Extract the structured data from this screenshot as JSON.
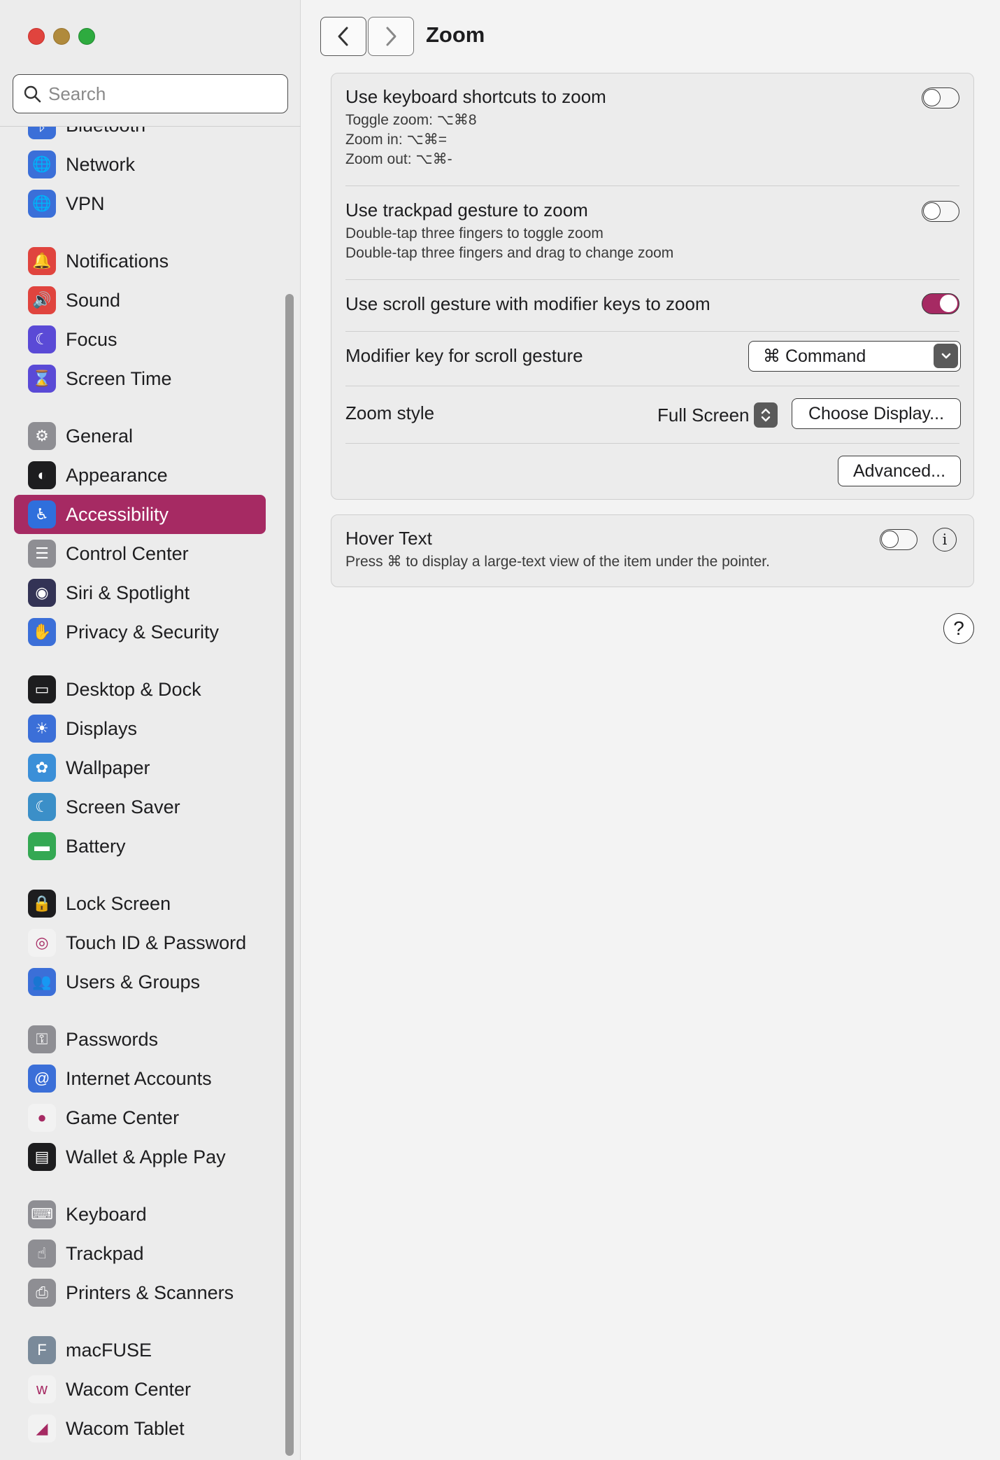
{
  "search": {
    "placeholder": "Search"
  },
  "sidebar": {
    "partial_item": "Bluetooth",
    "groups": [
      [
        {
          "label": "Network",
          "icon": "globe-icon",
          "color": "#3b6fd8"
        },
        {
          "label": "VPN",
          "icon": "globe-vpn-icon",
          "color": "#3b6fd8"
        }
      ],
      [
        {
          "label": "Notifications",
          "icon": "bell-icon",
          "color": "#e0443e"
        },
        {
          "label": "Sound",
          "icon": "speaker-icon",
          "color": "#e0443e"
        },
        {
          "label": "Focus",
          "icon": "moon-icon",
          "color": "#5a4ad6"
        },
        {
          "label": "Screen Time",
          "icon": "hourglass-icon",
          "color": "#5a4ad6"
        }
      ],
      [
        {
          "label": "General",
          "icon": "gear-icon",
          "color": "#8e8e93"
        },
        {
          "label": "Appearance",
          "icon": "appearance-icon",
          "color": "#1d1d1f"
        },
        {
          "label": "Accessibility",
          "icon": "accessibility-icon",
          "color": "#2f6fdc"
        },
        {
          "label": "Control Center",
          "icon": "switches-icon",
          "color": "#8e8e93"
        },
        {
          "label": "Siri & Spotlight",
          "icon": "siri-icon",
          "color": "#333355"
        },
        {
          "label": "Privacy & Security",
          "icon": "hand-icon",
          "color": "#3b6fd8"
        }
      ],
      [
        {
          "label": "Desktop & Dock",
          "icon": "dock-icon",
          "color": "#1d1d1f"
        },
        {
          "label": "Displays",
          "icon": "sun-icon",
          "color": "#3b6fd8"
        },
        {
          "label": "Wallpaper",
          "icon": "flower-icon",
          "color": "#3b8fd8"
        },
        {
          "label": "Screen Saver",
          "icon": "screensaver-icon",
          "color": "#3b8fc8"
        },
        {
          "label": "Battery",
          "icon": "battery-icon",
          "color": "#34a853"
        }
      ],
      [
        {
          "label": "Lock Screen",
          "icon": "lock-icon",
          "color": "#1d1d1f"
        },
        {
          "label": "Touch ID & Password",
          "icon": "fingerprint-icon",
          "color": "#f2f2f2"
        },
        {
          "label": "Users & Groups",
          "icon": "users-icon",
          "color": "#3b6fd8"
        }
      ],
      [
        {
          "label": "Passwords",
          "icon": "key-icon",
          "color": "#8e8e93"
        },
        {
          "label": "Internet Accounts",
          "icon": "at-icon",
          "color": "#3b6fd8"
        },
        {
          "label": "Game Center",
          "icon": "gamecenter-icon",
          "color": "#f2f2f2"
        },
        {
          "label": "Wallet & Apple Pay",
          "icon": "wallet-icon",
          "color": "#1d1d1f"
        }
      ],
      [
        {
          "label": "Keyboard",
          "icon": "keyboard-icon",
          "color": "#8e8e93"
        },
        {
          "label": "Trackpad",
          "icon": "trackpad-icon",
          "color": "#8e8e93"
        },
        {
          "label": "Printers & Scanners",
          "icon": "printer-icon",
          "color": "#8e8e93"
        }
      ],
      [
        {
          "label": "macFUSE",
          "icon": "macfuse-icon",
          "color": "#7a8a9a"
        },
        {
          "label": "Wacom Center",
          "icon": "wacom-icon",
          "color": "#f2f2f2"
        },
        {
          "label": "Wacom Tablet",
          "icon": "tablet-icon",
          "color": "#f2f2f2"
        }
      ]
    ],
    "selected": "Accessibility",
    "accent": "#a62a63"
  },
  "main": {
    "title": "Zoom",
    "keyboard": {
      "title": "Use keyboard shortcuts to zoom",
      "line1": "Toggle zoom: ⌥⌘8",
      "line2": "Zoom in: ⌥⌘=",
      "line3": "Zoom out: ⌥⌘-",
      "enabled": false
    },
    "trackpad": {
      "title": "Use trackpad gesture to zoom",
      "line1": "Double-tap three fingers to toggle zoom",
      "line2": "Double-tap three fingers and drag to change zoom",
      "enabled": false
    },
    "scroll": {
      "title": "Use scroll gesture with modifier keys to zoom",
      "enabled": true
    },
    "modifier": {
      "label": "Modifier key for scroll gesture",
      "value": "⌘ Command"
    },
    "zoom_style": {
      "label": "Zoom style",
      "value": "Full Screen",
      "choose_display": "Choose Display..."
    },
    "advanced_button": "Advanced...",
    "hover_text": {
      "title": "Hover Text",
      "description": "Press ⌘ to display a large-text view of the item under the pointer.",
      "enabled": false
    },
    "help": "?"
  }
}
